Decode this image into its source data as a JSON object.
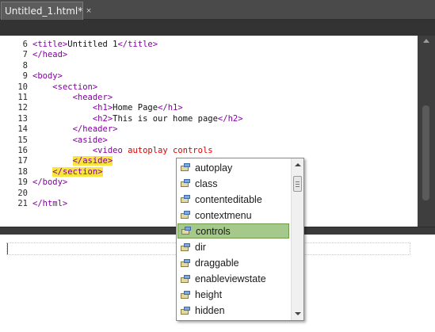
{
  "tab": {
    "label": "Untitled_1.html*",
    "close_glyph": "×"
  },
  "editor": {
    "lines": [
      {
        "num": "6",
        "tokens": [
          {
            "t": "<title>",
            "c": "tag"
          },
          {
            "t": "Untitled 1",
            "c": "txt"
          },
          {
            "t": "</title>",
            "c": "tag"
          }
        ]
      },
      {
        "num": "7",
        "tokens": [
          {
            "t": "</head>",
            "c": "tag"
          }
        ]
      },
      {
        "num": "8",
        "tokens": []
      },
      {
        "num": "9",
        "tokens": [
          {
            "t": "<body>",
            "c": "tag"
          }
        ]
      },
      {
        "num": "10",
        "tokens": [
          {
            "t": "    ",
            "c": "txt"
          },
          {
            "t": "<section>",
            "c": "tag"
          }
        ]
      },
      {
        "num": "11",
        "tokens": [
          {
            "t": "        ",
            "c": "txt"
          },
          {
            "t": "<header>",
            "c": "tag"
          }
        ]
      },
      {
        "num": "12",
        "tokens": [
          {
            "t": "            ",
            "c": "txt"
          },
          {
            "t": "<h1>",
            "c": "tag"
          },
          {
            "t": "Home Page",
            "c": "txt"
          },
          {
            "t": "</h1>",
            "c": "tag"
          }
        ]
      },
      {
        "num": "13",
        "tokens": [
          {
            "t": "            ",
            "c": "txt"
          },
          {
            "t": "<h2>",
            "c": "tag"
          },
          {
            "t": "This is our home page",
            "c": "txt"
          },
          {
            "t": "</h2>",
            "c": "tag"
          }
        ]
      },
      {
        "num": "14",
        "tokens": [
          {
            "t": "        ",
            "c": "txt"
          },
          {
            "t": "</header>",
            "c": "tag"
          }
        ]
      },
      {
        "num": "15",
        "tokens": [
          {
            "t": "        ",
            "c": "txt"
          },
          {
            "t": "<aside>",
            "c": "tag"
          }
        ]
      },
      {
        "num": "16",
        "tokens": [
          {
            "t": "            ",
            "c": "txt"
          },
          {
            "t": "<video ",
            "c": "tag"
          },
          {
            "t": "autoplay controls",
            "c": "attr"
          }
        ]
      },
      {
        "num": "17",
        "tokens": [
          {
            "t": "        ",
            "c": "txt"
          },
          {
            "t": "</aside>",
            "c": "tag hl"
          }
        ]
      },
      {
        "num": "18",
        "tokens": [
          {
            "t": "    ",
            "c": "txt"
          },
          {
            "t": "</section>",
            "c": "tag hl"
          }
        ]
      },
      {
        "num": "19",
        "tokens": [
          {
            "t": "</body>",
            "c": "tag"
          }
        ]
      },
      {
        "num": "20",
        "tokens": []
      },
      {
        "num": "21",
        "tokens": [
          {
            "t": "</html>",
            "c": "tag"
          }
        ]
      }
    ]
  },
  "intellisense": {
    "selected": "controls",
    "items": [
      {
        "label": "autoplay",
        "icon": "html-attribute-icon"
      },
      {
        "label": "class",
        "icon": "html-attribute-icon"
      },
      {
        "label": "contenteditable",
        "icon": "html-attribute-icon"
      },
      {
        "label": "contextmenu",
        "icon": "html-attribute-icon"
      },
      {
        "label": "controls",
        "icon": "html-attribute-icon"
      },
      {
        "label": "dir",
        "icon": "html-attribute-icon"
      },
      {
        "label": "draggable",
        "icon": "html-attribute-icon"
      },
      {
        "label": "enableviewstate",
        "icon": "html-attribute-icon"
      },
      {
        "label": "height",
        "icon": "html-attribute-icon"
      },
      {
        "label": "hidden",
        "icon": "html-attribute-icon"
      }
    ]
  },
  "colors": {
    "tag": "#8000a0",
    "attribute": "#e00000",
    "highlight": "#f7e43c",
    "selection": "#a5c98a"
  }
}
